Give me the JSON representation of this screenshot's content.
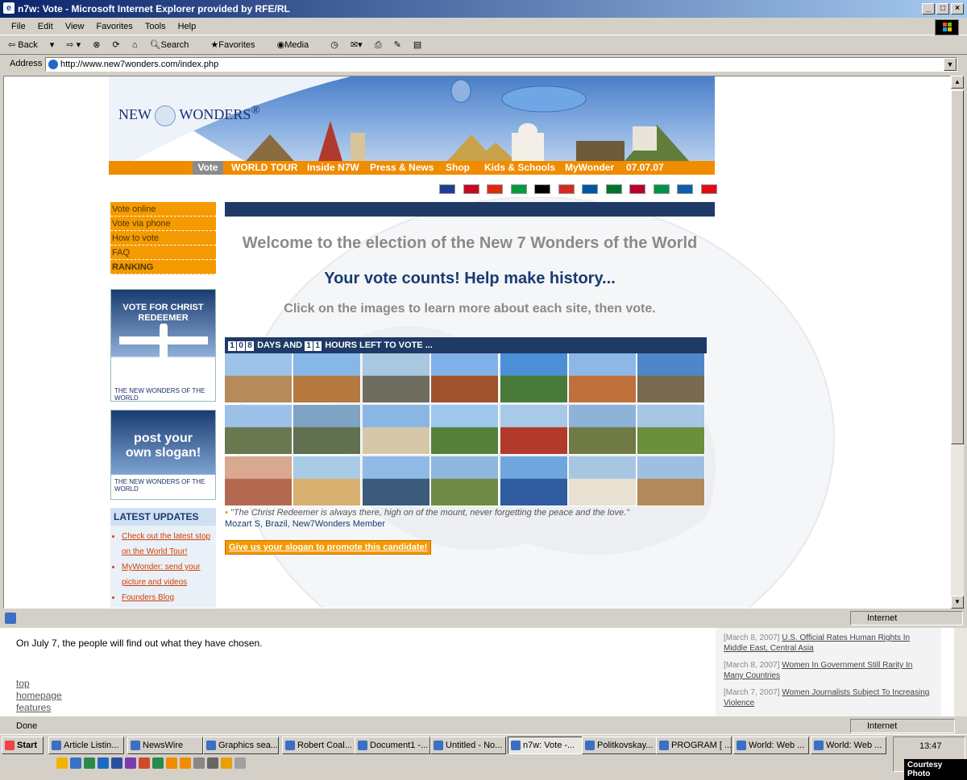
{
  "window": {
    "title": "n7w: Vote - Microsoft Internet Explorer provided by RFE/RL"
  },
  "menu": [
    "File",
    "Edit",
    "View",
    "Favorites",
    "Tools",
    "Help"
  ],
  "toolbar": {
    "back": "Back",
    "search": "Search",
    "favorites": "Favorites",
    "media": "Media"
  },
  "address": {
    "label": "Address",
    "url": "http://www.new7wonders.com/index.php"
  },
  "site": {
    "logo_left": "NEW",
    "logo_right": "WONDERS",
    "logo_reg": "®",
    "nav": [
      "Vote",
      "WORLD TOUR",
      "Inside N7W",
      "Press & News",
      "Shop",
      "Kids & Schools",
      "MyWonder",
      "07.07.07"
    ],
    "flag_colors": [
      "#1c3f94",
      "#c60b1e",
      "#de2910",
      "#009b3a",
      "#000000",
      "#d52b1e",
      "#0055a4",
      "#00732f",
      "#bc002d",
      "#009246",
      "#0d5eaf",
      "#e30a17"
    ],
    "sidebar_links": [
      "Vote online",
      "Vote via phone",
      "How to vote",
      "FAQ",
      "RANKING"
    ],
    "ad1": {
      "title": "VOTE FOR CHRIST REDEEMER",
      "brand": "THE NEW",
      "brand2": "WONDERS OF THE WORLD"
    },
    "ad2": {
      "title": "post your own slogan!",
      "brand": "THE NEW",
      "brand2": "WONDERS OF THE WORLD"
    },
    "updates": {
      "title": "LATEST UPDATES",
      "items": [
        "Check out the latest stop on the World Tour!",
        "MyWonder: send your picture and videos",
        "Founders Blog"
      ]
    },
    "welcome": "Welcome to the election of the New 7 Wonders of the World",
    "subhead": "Your vote counts! Help make history...",
    "instruction": "Click on the images to learn more about each site, then vote.",
    "countdown": {
      "days_digits": [
        "1",
        "0",
        "8"
      ],
      "days_text": "DAYS AND",
      "hours_digits": [
        "1",
        "1"
      ],
      "hours_text": "HOURS LEFT TO VOTE ..."
    },
    "quote": "\"The Christ Redeemer is always there, high on of the mount, never forgetting the peace and the love.\"",
    "quote_author": "Mozart S, Brazil, New7Wonders Member",
    "slogan_button": "Give us your slogan to promote this candidate!"
  },
  "status": {
    "left": "",
    "zone": "Internet",
    "done": "Done"
  },
  "lower": {
    "body": "On July 7, the people will find out what they have chosen.",
    "links": [
      "top",
      "homepage",
      "features"
    ],
    "news": [
      {
        "date": "[March 8, 2007]",
        "title": "U.S. Official Rates Human Rights In Middle East, Central Asia"
      },
      {
        "date": "[March 8, 2007]",
        "title": "Women In Government Still Rarity In Many Countries"
      },
      {
        "date": "[March 7, 2007]",
        "title": "Women Journalists Subject To Increasing Violence"
      }
    ]
  },
  "taskbar": {
    "start": "Start",
    "buttons": [
      "Article Listin...",
      "NewsWire",
      "Graphics sea...",
      "Robert Coal...",
      "Document1 -...",
      "Untitled - No...",
      "n7w: Vote -...",
      "Politkovskay...",
      "PROGRAM [ ...",
      "World: Web ...",
      "World: Web ..."
    ],
    "clock": "13:47",
    "credit": "Courtesy Photo"
  }
}
